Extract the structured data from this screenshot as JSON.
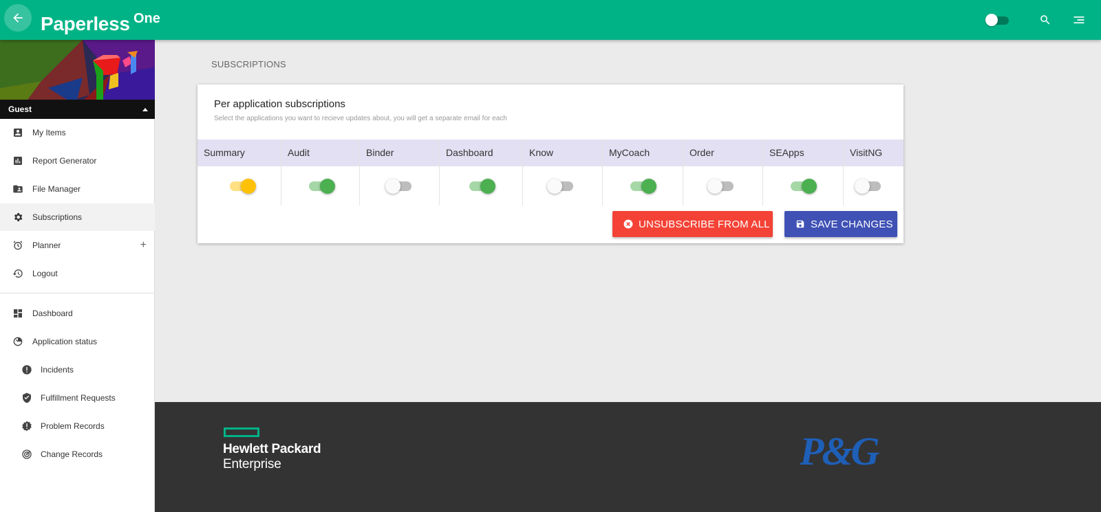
{
  "app": {
    "brand": "Paperless",
    "brand_sup": "One",
    "accent": "#00b386"
  },
  "topbar": {
    "icons": [
      "arrow-back-icon",
      "toggle-switch",
      "search-icon",
      "menu-icon"
    ]
  },
  "sidebar": {
    "user": "Guest",
    "items": [
      {
        "label": "My Items",
        "icon": "account-box-icon"
      },
      {
        "label": "Report Generator",
        "icon": "chart-icon"
      },
      {
        "label": "File Manager",
        "icon": "folder-account-icon"
      },
      {
        "label": "Subscriptions",
        "icon": "gear-icon",
        "active": true
      },
      {
        "label": "Planner",
        "icon": "alarm-icon"
      },
      {
        "label": "Logout",
        "icon": "history-icon"
      }
    ],
    "secondary": [
      {
        "label": "Dashboard",
        "icon": "dashboard-icon"
      },
      {
        "label": "Application status",
        "icon": "timelapse-icon"
      },
      {
        "label": "Incidents",
        "icon": "alert-circle-icon"
      },
      {
        "label": "Fulfillment Requests",
        "icon": "shield-check-icon"
      },
      {
        "label": "Problem Records",
        "icon": "alert-decagram-icon"
      },
      {
        "label": "Change Records",
        "icon": "radar-icon"
      }
    ]
  },
  "main": {
    "breadcrumb": "SUBSCRIPTIONS",
    "card_title": "Per application subscriptions",
    "card_subtitle": "Select the applications you want to recieve updates about, you will get a separate email for each",
    "columns": [
      {
        "label": "Summary",
        "state": true,
        "color": "#ffc107"
      },
      {
        "label": "Audit",
        "state": true,
        "color": "#4caf50"
      },
      {
        "label": "Binder",
        "state": false
      },
      {
        "label": "Dashboard",
        "state": true,
        "color": "#4caf50"
      },
      {
        "label": "Know",
        "state": false
      },
      {
        "label": "MyCoach",
        "state": true,
        "color": "#4caf50"
      },
      {
        "label": "Order",
        "state": false
      },
      {
        "label": "SEApps",
        "state": true,
        "color": "#4caf50"
      },
      {
        "label": "VisitNG",
        "state": false
      }
    ],
    "unsubscribe_label": "UNSUBSCRIBE FROM ALL",
    "save_label": "SAVE CHANGES"
  },
  "footer": {
    "hpe_line1": "Hewlett Packard",
    "hpe_line2": "Enterprise",
    "pg": "P&G"
  }
}
